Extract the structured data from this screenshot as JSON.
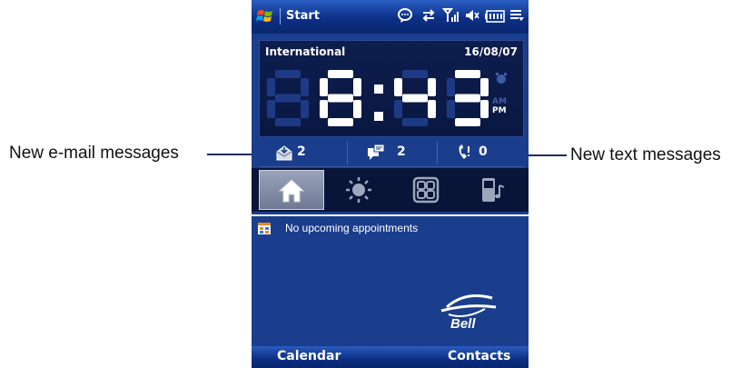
{
  "callouts": {
    "email": "New e-mail messages",
    "text": "New text messages"
  },
  "titlebar": {
    "title": "Start",
    "icons": [
      "windows-start-icon",
      "chat-bubble-icon",
      "sync-arrows-icon",
      "signal-icon",
      "speaker-icon",
      "battery-icon",
      "menu-icon"
    ]
  },
  "clock": {
    "location": "International",
    "date": "16/08/07",
    "time": "8:43",
    "am": "AM",
    "pm": "PM",
    "digit_on_color": "#ffffff",
    "digit_off_color": "#1f3a85"
  },
  "notifications": {
    "email_count": "2",
    "sms_count": "2",
    "missed_calls": "0"
  },
  "tabs": [
    {
      "name": "home",
      "selected": true
    },
    {
      "name": "weather"
    },
    {
      "name": "launcher"
    },
    {
      "name": "music"
    }
  ],
  "appointments": {
    "text": "No upcoming appointments"
  },
  "logo": {
    "text": "Bell"
  },
  "softkeys": {
    "left": "Calendar",
    "right": "Contacts"
  },
  "colors": {
    "background": "#1a3e8c",
    "titlebar": "#0c2f86",
    "clock_panel": "#0a1842"
  }
}
